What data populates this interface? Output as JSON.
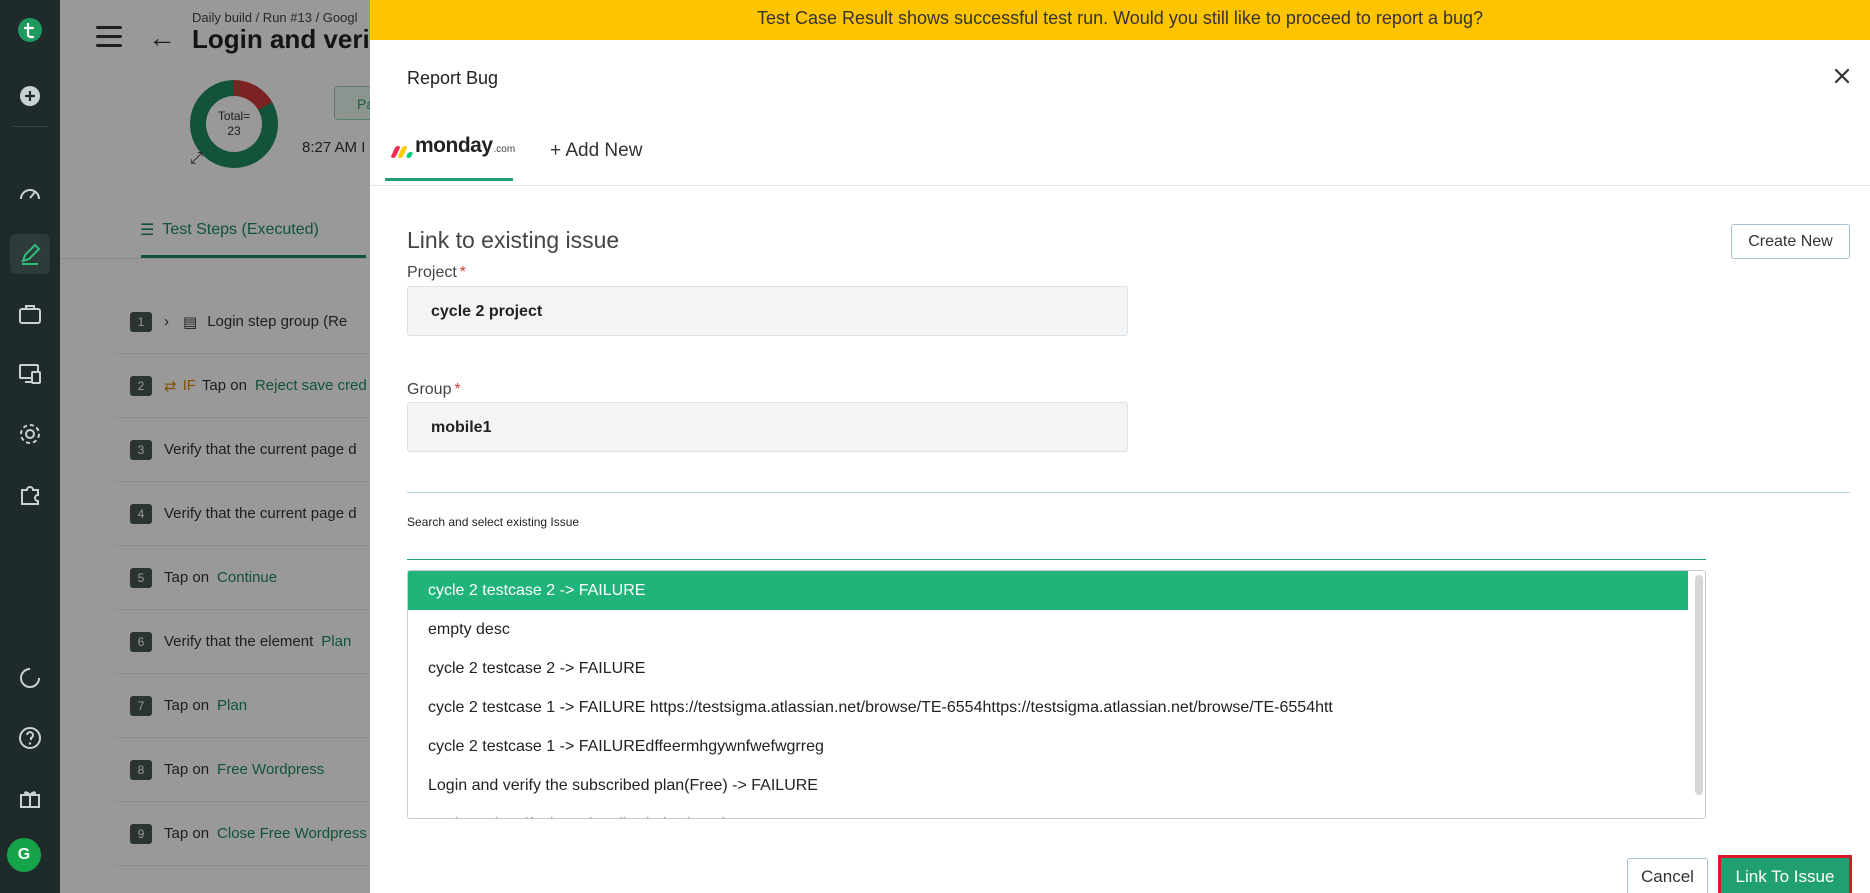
{
  "sidebar": {
    "icons": [
      "testsigma-logo-icon",
      "add-icon",
      "dashboard-icon",
      "edit-icon",
      "briefcase-icon",
      "devices-icon",
      "settings-icon",
      "addons-icon",
      "loader-icon",
      "help-icon",
      "gift-icon"
    ],
    "avatar_letter": "G"
  },
  "background": {
    "breadcrumb": "Daily build / Run #13 / Googl",
    "title": "Login and verify",
    "donut_total_label": "Total=",
    "donut_total": "23",
    "status_short": "Pa",
    "time": "8:27 AM I",
    "tab_label": "Test Steps (Executed)",
    "steps": [
      {
        "num": "1",
        "pre": "",
        "text": "Login step group (Re",
        "green": ""
      },
      {
        "num": "2",
        "pre": "IF",
        "text": "Tap on",
        "green": "Reject save cred"
      },
      {
        "num": "3",
        "pre": "",
        "text": "Verify that the current page d",
        "green": ""
      },
      {
        "num": "4",
        "pre": "",
        "text": "Verify that the current page d",
        "green": ""
      },
      {
        "num": "5",
        "pre": "",
        "text": "Tap on",
        "green": "Continue"
      },
      {
        "num": "6",
        "pre": "",
        "text": "Verify that the element",
        "green": "Plan"
      },
      {
        "num": "7",
        "pre": "",
        "text": "Tap on",
        "green": "Plan"
      },
      {
        "num": "8",
        "pre": "",
        "text": "Tap on",
        "green": "Free Wordpress"
      },
      {
        "num": "9",
        "pre": "",
        "text": "Tap on",
        "green": "Close Free Wordpress"
      }
    ]
  },
  "modal": {
    "warning": "Test Case Result shows successful test run. Would you still like to proceed to report a bug?",
    "title": "Report Bug",
    "provider": {
      "name": "monday",
      "suffix": ".com"
    },
    "add_new": "+ Add New",
    "section_title": "Link to existing issue",
    "create_new": "Create New",
    "project_label": "Project",
    "project_value": "cycle 2 project",
    "group_label": "Group",
    "group_value": "mobile1",
    "search_label": "Search and select existing Issue",
    "search_value": "",
    "issues": [
      "cycle 2 testcase 2 -> FAILURE",
      "empty desc",
      "cycle 2 testcase 2 -> FAILURE",
      "cycle 2 testcase 1 -> FAILURE https://testsigma.atlassian.net/browse/TE-6554https://testsigma.atlassian.net/browse/TE-6554htt",
      "cycle 2 testcase 1 -> FAILUREdffeermhgywnfwefwgrreg",
      "Login and verify the subscribed plan(Free) -> FAILURE",
      "Login and verify the subscribed plan(Free) -> SUCCESS"
    ],
    "selected_issue_index": 0,
    "cancel": "Cancel",
    "link": "Link To Issue"
  },
  "colors": {
    "accent": "#20a070",
    "warning_bar": "#ffc400",
    "rail": "#1f2a2a",
    "highlight_border": "#e0162b"
  }
}
